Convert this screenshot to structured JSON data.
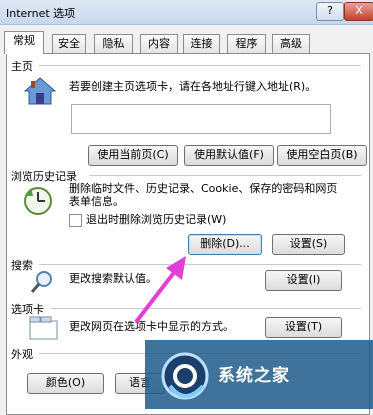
{
  "window": {
    "title": "Internet 选项",
    "help_label": "?",
    "close_label": "X"
  },
  "tabs": [
    "常规",
    "安全",
    "隐私",
    "内容",
    "连接",
    "程序",
    "高级"
  ],
  "homepage": {
    "section_label": "主页",
    "instruction": "若要创建主页选项卡，请在各地址行键入地址(R)。",
    "buttons": [
      "使用当前页(C)",
      "使用默认值(F)",
      "使用空白页(B)"
    ]
  },
  "history": {
    "section_label": "浏览历史记录",
    "description_line1": "删除临时文件、历史记录、Cookie、保存的密码和网页",
    "description_line2": "表单信息。",
    "checkbox_label": "退出时删除浏览历史记录(W)",
    "delete_button": "删除(D)...",
    "settings_button": "设置(S)"
  },
  "search": {
    "section_label": "搜索",
    "description": "更改搜索默认值。",
    "settings_button": "设置(I)"
  },
  "tabs_section": {
    "section_label": "选项卡",
    "description": "更改网页在选项卡中显示的方式。",
    "settings_button": "设置(T)"
  },
  "appearance": {
    "section_label": "外观",
    "colors_button": "颜色(O)",
    "languages_button": "语言"
  },
  "watermark": {
    "text": "系统之家"
  },
  "colors": {
    "annotation_arrow": "#e23fd6",
    "focus_border": "#3c7fb1"
  }
}
